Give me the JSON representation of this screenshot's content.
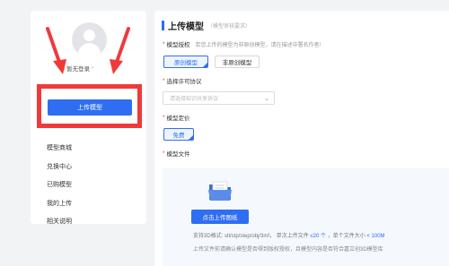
{
  "sidebar": {
    "login_label": "暂无登录",
    "upload_button": "上传模型",
    "nav_items": [
      "模型商城",
      "兑换中心",
      "已购模型",
      "我的上传",
      "相关说明"
    ]
  },
  "main": {
    "title": "上传模型",
    "title_hint": "（模型审核要求）",
    "auth": {
      "label": "模型授权",
      "description": "若您上传的模型为非原创模型，请在描述中署名作者!",
      "options": [
        "原创模型",
        "非原创模型"
      ],
      "selected": "原创模型"
    },
    "license": {
      "label": "选择许可协议",
      "placeholder": "请选择知识共享协议"
    },
    "price": {
      "label": "模型定价",
      "selected": "免费"
    },
    "file": {
      "label": "模型文件",
      "upload_button": "点击上传图纸",
      "formats_prefix": "支持3D格式:  stl/stp/step/obj/3mf，  单次上传文件",
      "count_limit": "≤20 个",
      "size_prefix": "，单个文件大小",
      "size_limit": "< 100M",
      "notice": "上传文件前请确认模型是否得到版权授权，且模型内容是否符合嘉立创3D模型库"
    }
  },
  "colors": {
    "accent": "#2f6ef3",
    "highlight": "#f03a3a",
    "required": "#e84040"
  }
}
